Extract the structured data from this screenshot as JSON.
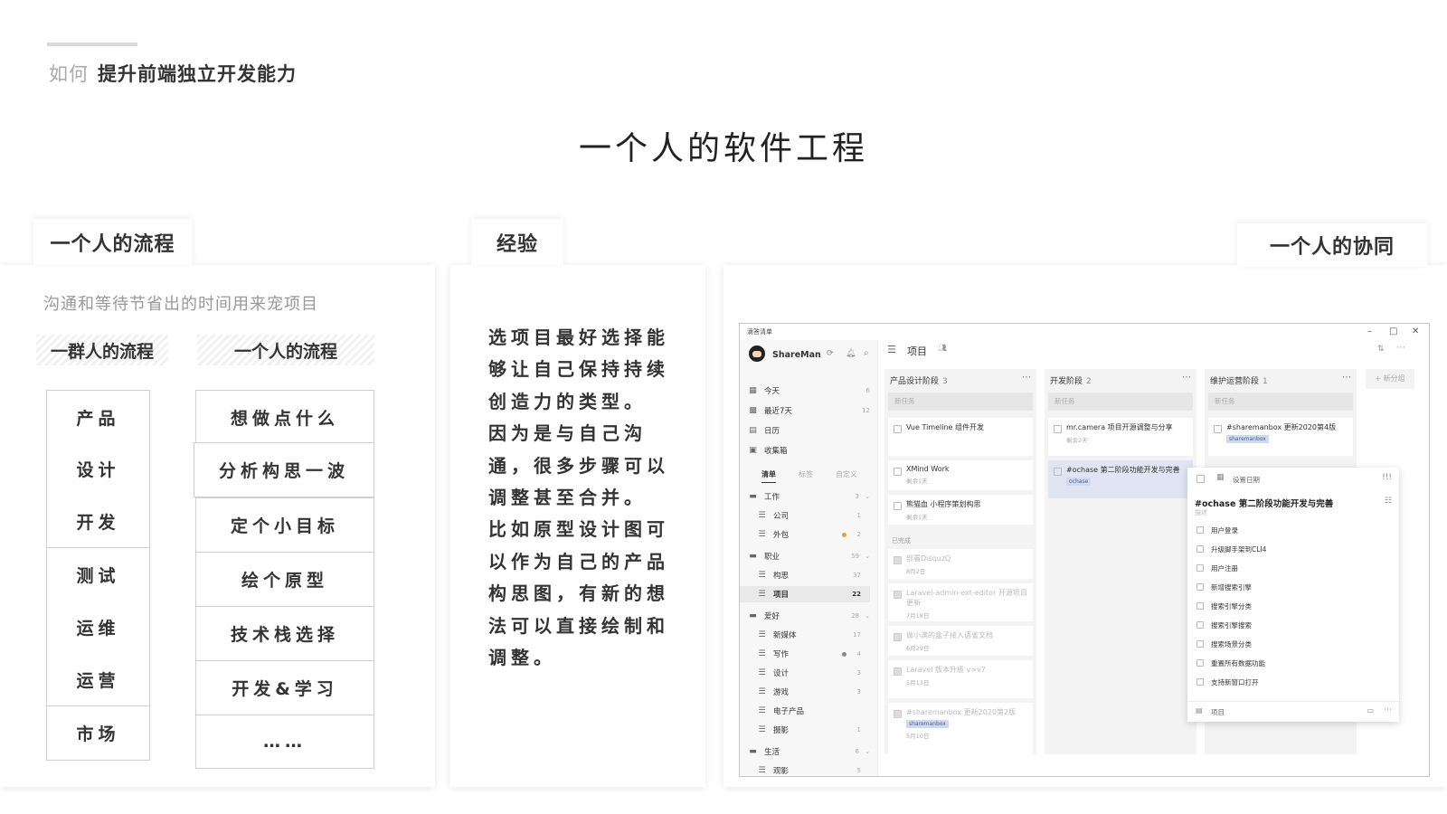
{
  "header": {
    "prefix": "如何",
    "title": "提升前端独立开发能力"
  },
  "main_title": "一个人的软件工程",
  "panel1": {
    "tab": "一个人的流程",
    "subtitle": "沟通和等待节省出的时间用来宠项目",
    "left_head": "一群人的流程",
    "right_head": "一个人的流程",
    "left_steps": [
      "产品",
      "设计",
      "开发",
      "测试",
      "运维",
      "运营",
      "市场"
    ],
    "right_steps": [
      "想做点什么",
      "分析构思一波",
      "定个小目标",
      "绘个原型",
      "技术栈选择",
      "开发&学习",
      "……"
    ]
  },
  "panel2": {
    "tab": "经验",
    "lines": [
      "选项目最好选择能",
      "够让自己保持持续",
      "创造力的类型。",
      "因为是与自己沟",
      "通，很多步骤可以",
      "调整甚至合并。",
      "比如原型设计图可",
      "以作为自己的产品",
      "构思图，有新的想",
      "法可以直接绘制和",
      "调整。"
    ]
  },
  "panel3": {
    "tab": "一个人的协同",
    "app": {
      "title": "滴答清单",
      "user": "ShareMan",
      "window_controls": [
        "–",
        "□",
        "✕"
      ],
      "project_title": "项目",
      "add_group": "+ 新分组",
      "smart_lists": [
        {
          "icon": "calendar-icon",
          "label": "今天",
          "count": "6"
        },
        {
          "icon": "calendar-week-icon",
          "label": "最近7天",
          "count": "12"
        },
        {
          "icon": "calendar-icon",
          "label": "日历",
          "count": ""
        },
        {
          "icon": "inbox-icon",
          "label": "收集箱",
          "count": ""
        }
      ],
      "tabs": [
        "清单",
        "标签",
        "自定义"
      ],
      "folders": [
        {
          "label": "工作",
          "count": "3",
          "lists": [
            {
              "label": "公司",
              "count": "1"
            },
            {
              "label": "外包",
              "count": "2"
            }
          ]
        },
        {
          "label": "职业",
          "count": "59",
          "lists": [
            {
              "label": "构思",
              "count": "37"
            },
            {
              "label": "项目",
              "count": "22"
            }
          ]
        },
        {
          "label": "爱好",
          "count": "28",
          "lists": [
            {
              "label": "新媒体",
              "count": "17"
            },
            {
              "label": "写作",
              "count": "4"
            },
            {
              "label": "设计",
              "count": "3"
            },
            {
              "label": "游戏",
              "count": "3"
            },
            {
              "label": "电子产品",
              "count": ""
            },
            {
              "label": "摄影",
              "count": "1"
            }
          ]
        },
        {
          "label": "生活",
          "count": "6",
          "lists": [
            {
              "label": "观影",
              "count": "5"
            }
          ]
        }
      ],
      "columns": [
        {
          "name": "产品设计阶段",
          "count": "3",
          "new_task": "新任务",
          "cards": [
            {
              "text": "Vue Timeline 组件开发",
              "meta": ""
            },
            {
              "text": "XMind Work",
              "meta": "剩余1天"
            },
            {
              "text": "熊猫血 小程序策划构思",
              "meta": "剩余1天"
            }
          ],
          "done_label": "已完成",
          "done_cards": [
            {
              "text": "部署DisquzQ",
              "meta": "8月2日"
            },
            {
              "text": "Laravel-admin-ext-editor 开源项目更新",
              "meta": "7月18日"
            },
            {
              "text": "做小满的盒子接入语雀文档",
              "meta": "6月29日"
            },
            {
              "text": "Laravel 版本升级 v>v7",
              "meta": "5月13日"
            },
            {
              "text": "#sharemanbox 更新2020第2版",
              "tag": "sharemanbox",
              "meta": "5月10日"
            }
          ]
        },
        {
          "name": "开发阶段",
          "count": "2",
          "new_task": "新任务",
          "cards": [
            {
              "text": "mr.camera 项目开源调整与分享",
              "meta": "剩余2天"
            },
            {
              "text": "#ochase 第二阶段功能开发与完善",
              "tag": "ochase",
              "meta": ""
            }
          ]
        },
        {
          "name": "维护运营阶段",
          "count": "1",
          "new_task": "新任务",
          "cards": [
            {
              "text": "#sharemanbox 更新2020第4版",
              "tag": "sharemanbox",
              "meta": ""
            }
          ]
        }
      ],
      "detail": {
        "date_label": "设置日期",
        "title": "#ochase 第二阶段功能开发与完善",
        "desc_placeholder": "描述",
        "subtasks": [
          "用户登录",
          "升级脚手架到CLI4",
          "用户注册",
          "新增搜索引擎",
          "搜索引擎分类",
          "搜索引擎搜索",
          "搜索场景分类",
          "重置所有数据功能",
          "支持新窗口打开"
        ],
        "footer": "项目"
      }
    }
  }
}
